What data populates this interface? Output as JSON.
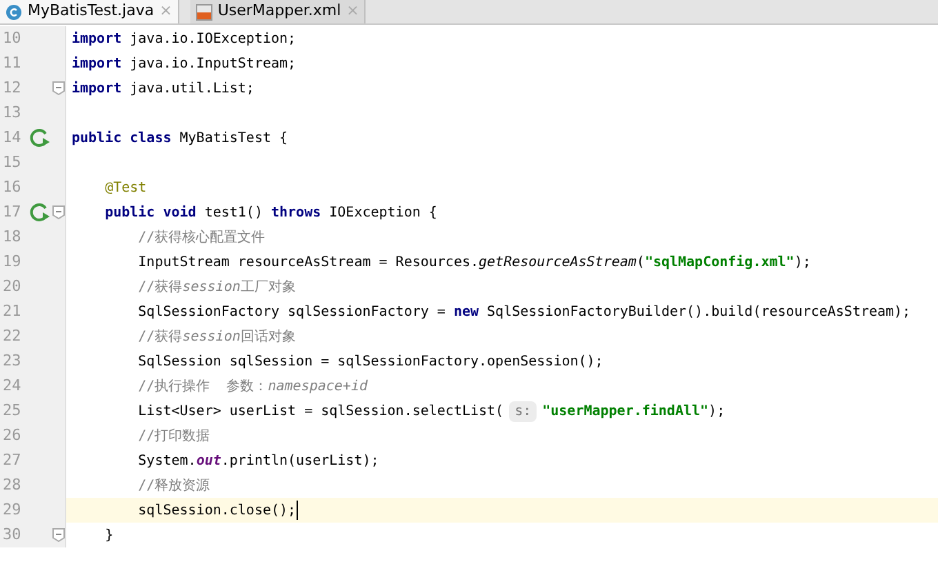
{
  "tabs": [
    {
      "label": "MyBatisTest.java",
      "close": "×",
      "kind": "java",
      "selected": true
    },
    {
      "label": "UserMapper.xml",
      "close": "×",
      "kind": "xml",
      "selected": false
    }
  ],
  "editor": {
    "lines": [
      {
        "number": "10",
        "run": false,
        "fold": false,
        "current": false,
        "tokens": [
          {
            "kind": "keyword",
            "text": "import"
          },
          {
            "kind": "plain",
            "text": " java.io.IOException;"
          }
        ]
      },
      {
        "number": "11",
        "run": false,
        "fold": false,
        "current": false,
        "tokens": [
          {
            "kind": "keyword",
            "text": "import"
          },
          {
            "kind": "plain",
            "text": " java.io.InputStream;"
          }
        ]
      },
      {
        "number": "12",
        "run": false,
        "fold": true,
        "current": false,
        "tokens": [
          {
            "kind": "keyword",
            "text": "import"
          },
          {
            "kind": "plain",
            "text": " java.util.List;"
          }
        ]
      },
      {
        "number": "13",
        "run": false,
        "fold": false,
        "current": false
      },
      {
        "number": "14",
        "run": true,
        "fold": false,
        "current": false,
        "tokens": [
          {
            "kind": "keyword",
            "text": "public class"
          },
          {
            "kind": "plain",
            "text": " MyBatisTest {"
          }
        ]
      },
      {
        "number": "15",
        "run": false,
        "fold": false,
        "current": false
      },
      {
        "number": "16",
        "run": false,
        "fold": false,
        "current": false,
        "tokens": [
          {
            "kind": "annotation",
            "text": "    @Test"
          }
        ]
      },
      {
        "number": "17",
        "run": true,
        "fold": true,
        "current": false,
        "tokens": [
          {
            "kind": "keyword",
            "text": "    public void"
          },
          {
            "kind": "plain",
            "text": " test1() "
          },
          {
            "kind": "keyword",
            "text": "throws"
          },
          {
            "kind": "plain",
            "text": " IOException {"
          }
        ]
      },
      {
        "number": "18",
        "run": false,
        "fold": false,
        "current": false,
        "tokens": [
          {
            "kind": "comment",
            "text": "        //获得核心配置文件"
          }
        ]
      },
      {
        "number": "19",
        "run": false,
        "fold": false,
        "current": false,
        "tokens": [
          {
            "kind": "plain",
            "text": "        InputStream resourceAsStream = Resources."
          },
          {
            "kind": "static-method",
            "text": "getResourceAsStream"
          },
          {
            "kind": "plain",
            "text": "("
          },
          {
            "kind": "string",
            "text": "\"sqlMapConfig.xml\""
          },
          {
            "kind": "plain",
            "text": ");"
          }
        ]
      },
      {
        "number": "20",
        "run": false,
        "fold": false,
        "current": false,
        "tokens": [
          {
            "kind": "comment",
            "text": "        //获得"
          },
          {
            "kind": "comment-italic",
            "text": "session"
          },
          {
            "kind": "comment",
            "text": "工厂对象"
          }
        ]
      },
      {
        "number": "21",
        "run": false,
        "fold": false,
        "current": false,
        "tokens": [
          {
            "kind": "plain",
            "text": "        SqlSessionFactory sqlSessionFactory = "
          },
          {
            "kind": "keyword",
            "text": "new"
          },
          {
            "kind": "plain",
            "text": " SqlSessionFactoryBuilder().build(resourceAsStream);"
          }
        ]
      },
      {
        "number": "22",
        "run": false,
        "fold": false,
        "current": false,
        "tokens": [
          {
            "kind": "comment",
            "text": "        //获得"
          },
          {
            "kind": "comment-italic",
            "text": "session"
          },
          {
            "kind": "comment",
            "text": "回话对象"
          }
        ]
      },
      {
        "number": "23",
        "run": false,
        "fold": false,
        "current": false,
        "tokens": [
          {
            "kind": "plain",
            "text": "        SqlSession sqlSession = sqlSessionFactory.openSession();"
          }
        ]
      },
      {
        "number": "24",
        "run": false,
        "fold": false,
        "current": false,
        "tokens": [
          {
            "kind": "comment",
            "text": "        //执行操作  参数："
          },
          {
            "kind": "comment-italic",
            "text": "namespace+id"
          }
        ]
      },
      {
        "number": "25",
        "run": false,
        "fold": false,
        "current": false,
        "tokens": [
          {
            "kind": "plain",
            "text": "        List<User> userList = sqlSession.selectList("
          },
          {
            "kind": "hint",
            "text": "s:"
          },
          {
            "kind": "string",
            "text": "\"userMapper.findAll\""
          },
          {
            "kind": "plain",
            "text": ");"
          }
        ]
      },
      {
        "number": "26",
        "run": false,
        "fold": false,
        "current": false,
        "tokens": [
          {
            "kind": "comment",
            "text": "        //打印数据"
          }
        ]
      },
      {
        "number": "27",
        "run": false,
        "fold": false,
        "current": false,
        "tokens": [
          {
            "kind": "plain",
            "text": "        System."
          },
          {
            "kind": "static-field",
            "text": "out"
          },
          {
            "kind": "plain",
            "text": ".println(userList);"
          }
        ]
      },
      {
        "number": "28",
        "run": false,
        "fold": false,
        "current": false,
        "tokens": [
          {
            "kind": "comment",
            "text": "        //释放资源"
          }
        ]
      },
      {
        "number": "29",
        "run": false,
        "fold": false,
        "current": true,
        "tokens": [
          {
            "kind": "plain",
            "text": "        sqlSession.close();"
          }
        ]
      },
      {
        "number": "30",
        "run": false,
        "fold": true,
        "current": false,
        "tokens": [
          {
            "kind": "plain",
            "text": "    }"
          }
        ]
      }
    ]
  }
}
